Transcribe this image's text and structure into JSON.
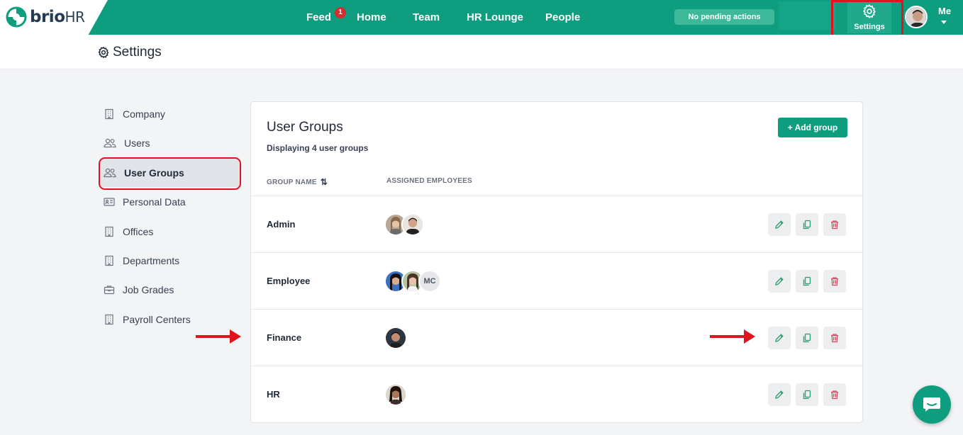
{
  "brand": {
    "name": "brio",
    "suffix": "HR",
    "color": "#0f9d7f"
  },
  "nav": {
    "feed": "Feed",
    "feed_badge": "1",
    "home": "Home",
    "team": "Team",
    "lounge": "HR Lounge",
    "people": "People",
    "pending": "No pending actions",
    "settings": "Settings",
    "me": "Me"
  },
  "page": {
    "title": "Settings"
  },
  "sidebar": {
    "items": [
      {
        "label": "Company",
        "icon": "building-icon"
      },
      {
        "label": "Users",
        "icon": "users-icon"
      },
      {
        "label": "User Groups",
        "icon": "users-icon",
        "active": true
      },
      {
        "label": "Personal Data",
        "icon": "id-card-icon"
      },
      {
        "label": "Offices",
        "icon": "building-icon"
      },
      {
        "label": "Departments",
        "icon": "building-icon"
      },
      {
        "label": "Job Grades",
        "icon": "briefcase-icon"
      },
      {
        "label": "Payroll Centers",
        "icon": "building-icon"
      }
    ]
  },
  "groups": {
    "title": "User Groups",
    "subtitle": "Displaying 4 user groups",
    "add_label": "+ Add group",
    "col_name": "GROUP NAME",
    "col_assigned": "ASSIGNED EMPLOYEES",
    "rows": [
      {
        "name": "Admin",
        "assigned": [
          "avatar",
          "avatar"
        ]
      },
      {
        "name": "Employee",
        "assigned": [
          "avatar",
          "avatar",
          "MC"
        ]
      },
      {
        "name": "Finance",
        "assigned": [
          "avatar"
        ]
      },
      {
        "name": "HR",
        "assigned": [
          "avatar"
        ]
      }
    ]
  },
  "annotations": {
    "highlight_color": "#e0141c"
  }
}
